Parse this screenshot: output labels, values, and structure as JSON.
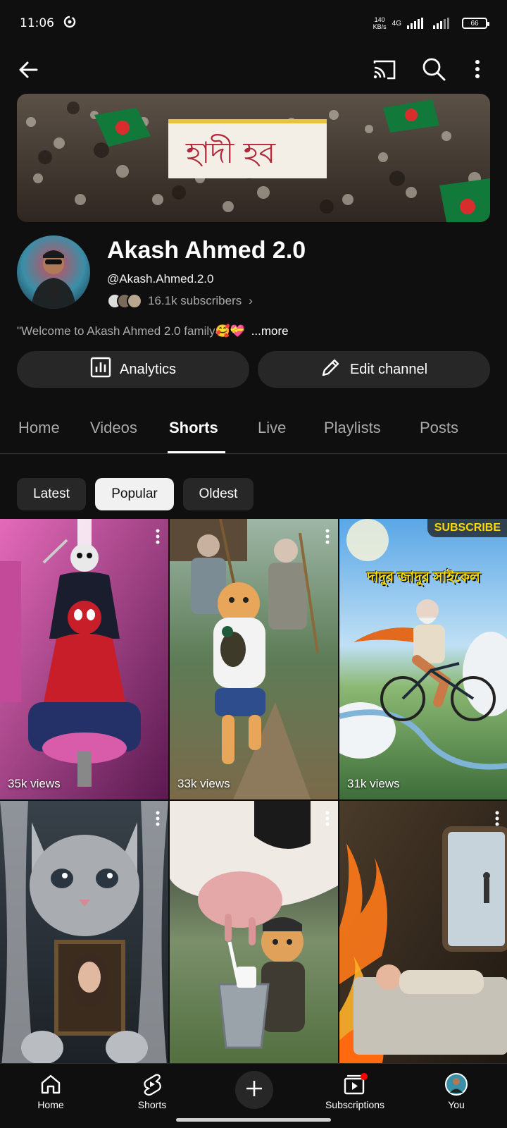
{
  "status_bar": {
    "time": "11:06",
    "net_speed_value": "140",
    "net_speed_unit": "KB/s",
    "network_type": "4G",
    "battery": "66"
  },
  "channel": {
    "name": "Akash Ahmed 2.0",
    "handle": "@Akash.Ahmed.2.0",
    "subscribers": "16.1k subscribers",
    "subscribers_chevron": "›",
    "description": "\"Welcome to Akash Ahmed 2.0 family🥰💝",
    "description_more": "...more"
  },
  "actions": {
    "analytics_label": "Analytics",
    "edit_label": "Edit channel"
  },
  "tabs": [
    {
      "label": "Home"
    },
    {
      "label": "Videos"
    },
    {
      "label": "Shorts"
    },
    {
      "label": "Live"
    },
    {
      "label": "Playlists"
    },
    {
      "label": "Posts"
    }
  ],
  "active_tab": "Shorts",
  "chips": [
    {
      "label": "Latest"
    },
    {
      "label": "Popular"
    },
    {
      "label": "Oldest"
    }
  ],
  "selected_chip": "Popular",
  "shorts": [
    {
      "views": "35k views"
    },
    {
      "views": "33k views"
    },
    {
      "views": "31k views",
      "overlay_title": "দাদুর জাদুর সাইকেল",
      "badge": "SUBSCRIBE"
    },
    {
      "views": ""
    },
    {
      "views": ""
    },
    {
      "views": ""
    }
  ],
  "bottom_nav": [
    {
      "label": "Home"
    },
    {
      "label": "Shorts"
    },
    {
      "label": "Subscriptions"
    },
    {
      "label": "You"
    }
  ],
  "colors": {
    "background": "#0f0f0f",
    "chip_bg": "#272727",
    "chip_selected_bg": "#f1f1f1",
    "subscribe_badge_text": "#ffd800",
    "notification_dot": "#ff0000"
  }
}
